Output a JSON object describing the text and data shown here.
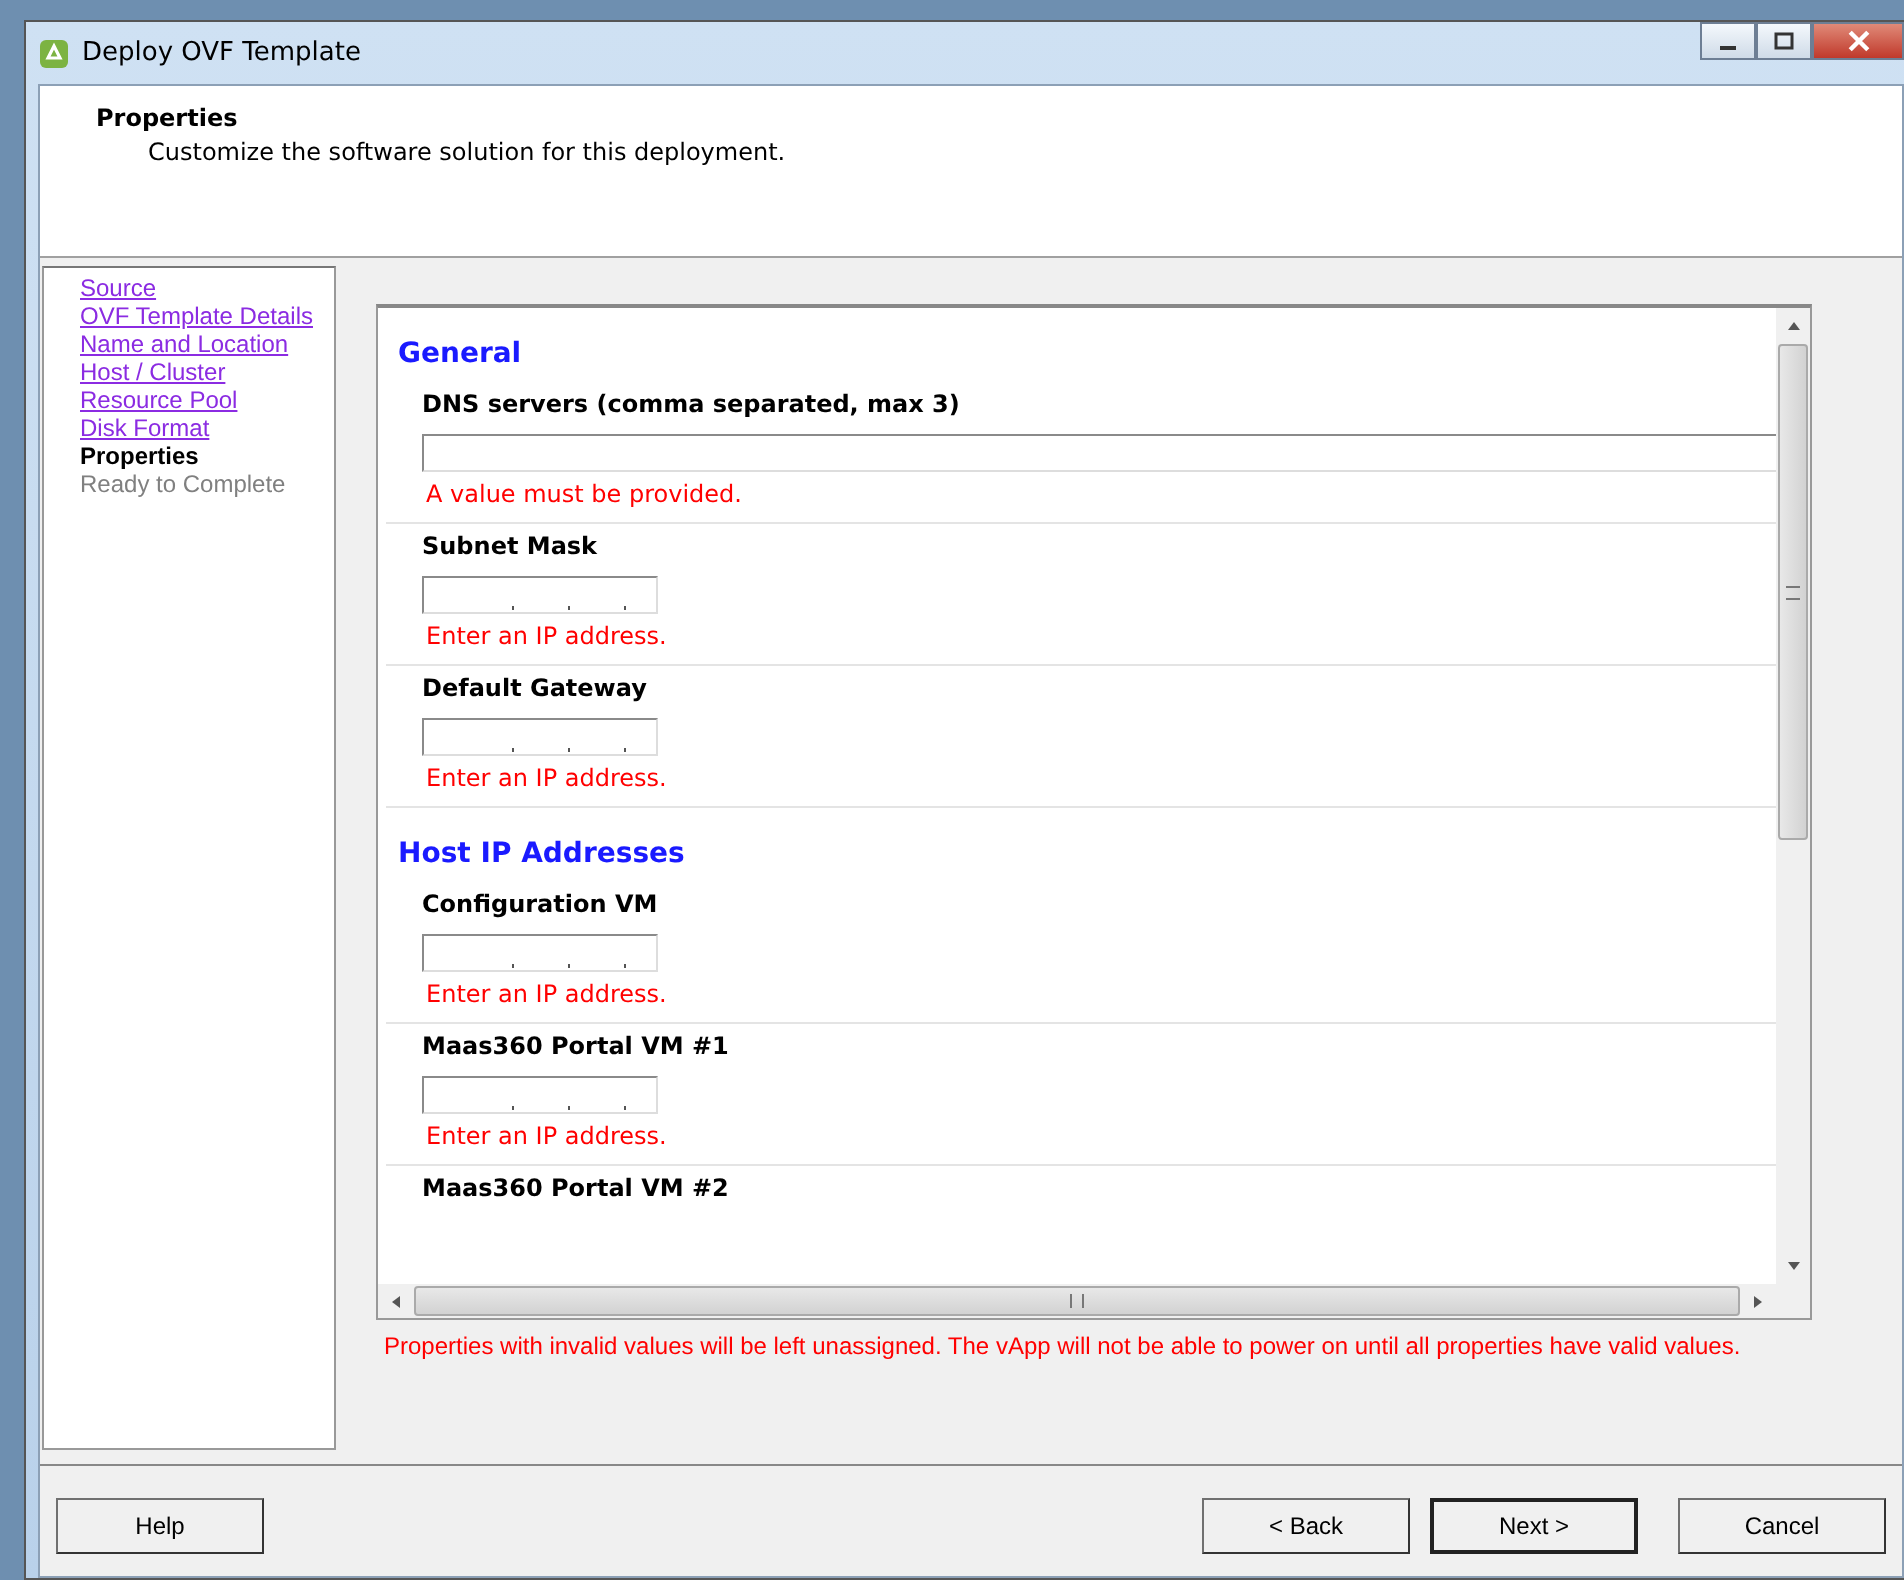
{
  "window": {
    "title": "Deploy OVF Template"
  },
  "header": {
    "title": "Properties",
    "subtitle": "Customize the software solution for this deployment."
  },
  "sidebar": {
    "items": [
      {
        "label": "Source",
        "kind": "link",
        "selected": false
      },
      {
        "label": "OVF Template Details",
        "kind": "link",
        "selected": false
      },
      {
        "label": "Name and Location",
        "kind": "link",
        "selected": false
      },
      {
        "label": "Host / Cluster",
        "kind": "link",
        "selected": false
      },
      {
        "label": "Resource Pool",
        "kind": "link",
        "selected": false
      },
      {
        "label": "Disk Format",
        "kind": "link",
        "selected": false
      },
      {
        "label": "Properties",
        "kind": "current",
        "selected": true
      },
      {
        "label": "Ready to Complete",
        "kind": "pending",
        "selected": false
      }
    ]
  },
  "properties": [
    {
      "kind": "section",
      "label": "General"
    },
    {
      "kind": "text",
      "label": "DNS servers (comma separated, max 3)",
      "error": "A value must be provided."
    },
    {
      "kind": "ip",
      "label": "Subnet Mask",
      "error": "Enter an IP address."
    },
    {
      "kind": "ip",
      "label": "Default Gateway",
      "error": "Enter an IP address."
    },
    {
      "kind": "section",
      "label": "Host IP Addresses"
    },
    {
      "kind": "ip",
      "label": "Configuration VM",
      "error": "Enter an IP address."
    },
    {
      "kind": "ip",
      "label": "Maas360 Portal VM #1",
      "error": "Enter an IP address."
    },
    {
      "kind": "cut",
      "label": "Maas360 Portal VM #2"
    }
  ],
  "footer_message": "Properties with invalid values will be left unassigned. The vApp will not be able to power on until all properties have valid values.",
  "buttons": {
    "help": "Help",
    "back": "< Back",
    "next": "Next >",
    "cancel": "Cancel"
  }
}
